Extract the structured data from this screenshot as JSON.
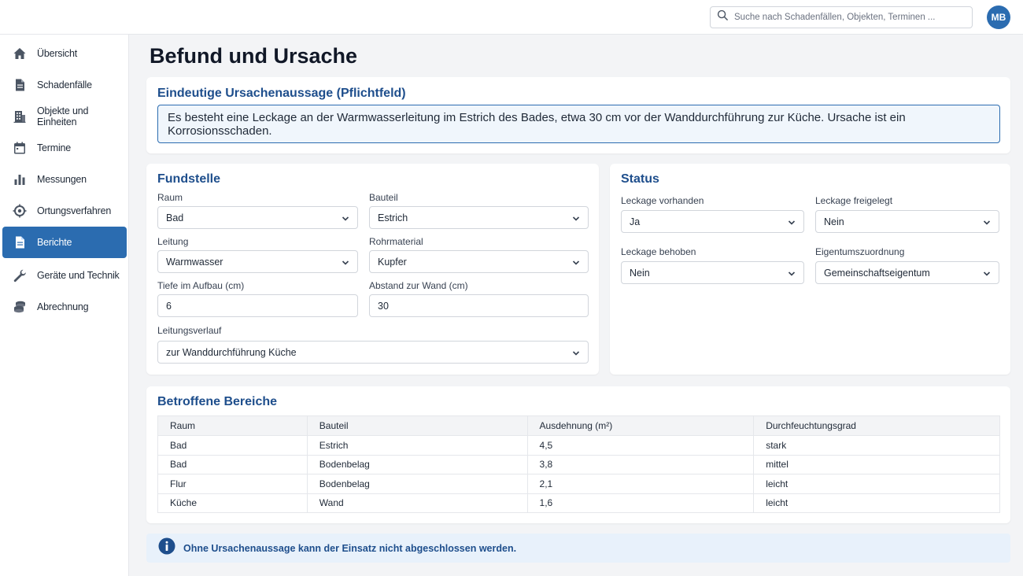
{
  "search": {
    "placeholder": "Suche nach Schadenfällen, Objekten, Terminen ..."
  },
  "user": {
    "initials": "MB"
  },
  "sidebar": {
    "items": [
      {
        "label": "Übersicht",
        "icon": "home-icon",
        "active": false
      },
      {
        "label": "Schadenfälle",
        "icon": "document-icon",
        "active": false
      },
      {
        "label": "Objekte und Einheiten",
        "icon": "building-icon",
        "active": false
      },
      {
        "label": "Termine",
        "icon": "calendar-icon",
        "active": false
      },
      {
        "label": "Messungen",
        "icon": "bar-chart-icon",
        "active": false
      },
      {
        "label": "Ortungsverfahren",
        "icon": "crosshair-icon",
        "active": false
      },
      {
        "label": "Berichte",
        "icon": "report-icon",
        "active": true
      },
      {
        "label": "Geräte und Technik",
        "icon": "wrench-icon",
        "active": false
      },
      {
        "label": "Abrechnung",
        "icon": "coins-icon",
        "active": false
      }
    ]
  },
  "page": {
    "title": "Befund und Ursache"
  },
  "cause": {
    "title": "Eindeutige Ursachenaussage (Pflichtfeld)",
    "value": "Es besteht eine Leckage an der Warmwasserleitung im Estrich des Bades, etwa 30 cm vor der Wanddurchführung zur Küche. Ursache ist ein Korrosionsschaden."
  },
  "fundstelle": {
    "title": "Fundstelle",
    "raum": {
      "label": "Raum",
      "value": "Bad"
    },
    "bauteil": {
      "label": "Bauteil",
      "value": "Estrich"
    },
    "leitung": {
      "label": "Leitung",
      "value": "Warmwasser"
    },
    "rohrmaterial": {
      "label": "Rohrmaterial",
      "value": "Kupfer"
    },
    "tiefe": {
      "label": "Tiefe im Aufbau (cm)",
      "value": "6"
    },
    "abstand": {
      "label": "Abstand zur Wand (cm)",
      "value": "30"
    },
    "verlauf": {
      "label": "Leitungsverlauf",
      "value": "zur Wanddurchführung Küche"
    }
  },
  "status": {
    "title": "Status",
    "leckage_vorhanden": {
      "label": "Leckage vorhanden",
      "value": "Ja"
    },
    "leckage_freigelegt": {
      "label": "Leckage freigelegt",
      "value": "Nein"
    },
    "leckage_behoben": {
      "label": "Leckage behoben",
      "value": "Nein"
    },
    "eigentum": {
      "label": "Eigentumszuordnung",
      "value": "Gemeinschaftseigentum"
    }
  },
  "areas": {
    "title": "Betroffene Bereiche",
    "headers": [
      "Raum",
      "Bauteil",
      "Ausdehnung (m²)",
      "Durchfeuchtungsgrad"
    ],
    "rows": [
      [
        "Bad",
        "Estrich",
        "4,5",
        "stark"
      ],
      [
        "Bad",
        "Bodenbelag",
        "3,8",
        "mittel"
      ],
      [
        "Flur",
        "Bodenbelag",
        "2,1",
        "leicht"
      ],
      [
        "Küche",
        "Wand",
        "1,6",
        "leicht"
      ]
    ]
  },
  "info": {
    "text": "Ohne Ursachenaussage kann der Einsatz nicht abgeschlossen werden.",
    "icon": "info-icon"
  },
  "colors": {
    "primary": "#2b6cb0",
    "heading": "#1e4e8c",
    "background": "#f3f4f6"
  }
}
